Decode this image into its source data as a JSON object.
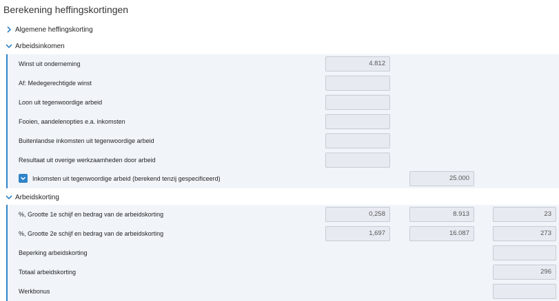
{
  "title": "Berekening heffingskortingen",
  "sections": {
    "algemene": {
      "label": "Algemene heffingskorting",
      "expanded": false
    },
    "arbeidsinkomen": {
      "label": "Arbeidsinkomen",
      "expanded": true,
      "rows": [
        {
          "label": "Winst uit onderneming",
          "value": "4.812"
        },
        {
          "label": "Af: Medegerechtigde winst",
          "value": ""
        },
        {
          "label": "Loon uit tegenwoordige arbeid",
          "value": ""
        },
        {
          "label": "Fooien, aandelenopties e.a. inkomsten",
          "value": ""
        },
        {
          "label": "Buitenlandse inkomsten uit tegenwoordige arbeid",
          "value": ""
        },
        {
          "label": "Resultaat uit overige werkzaamheden door arbeid",
          "value": ""
        }
      ],
      "total": {
        "label": "Inkomsten uit tegenwoordige arbeid (berekend tenzij gespecificeerd)",
        "value": "25.000",
        "checked": true
      }
    },
    "arbeidskorting": {
      "label": "Arbeidskorting",
      "expanded": true,
      "rows": [
        {
          "label": "%, Grootte 1e schijf en bedrag van de arbeidskorting",
          "pct": "0,258",
          "size": "8.913",
          "amount": "23"
        },
        {
          "label": "%, Grootte 2e schijf en bedrag van de arbeidskorting",
          "pct": "1,697",
          "size": "16.087",
          "amount": "273"
        },
        {
          "label": "Beperking arbeidskorting",
          "amount": ""
        },
        {
          "label": "Totaal arbeidskorting",
          "amount": "296"
        },
        {
          "label": "Werkbonus",
          "amount": ""
        }
      ]
    }
  },
  "colors": {
    "accent": "#2f84c9",
    "panel": "#f1f5fa",
    "field": "#e7ebf1"
  }
}
